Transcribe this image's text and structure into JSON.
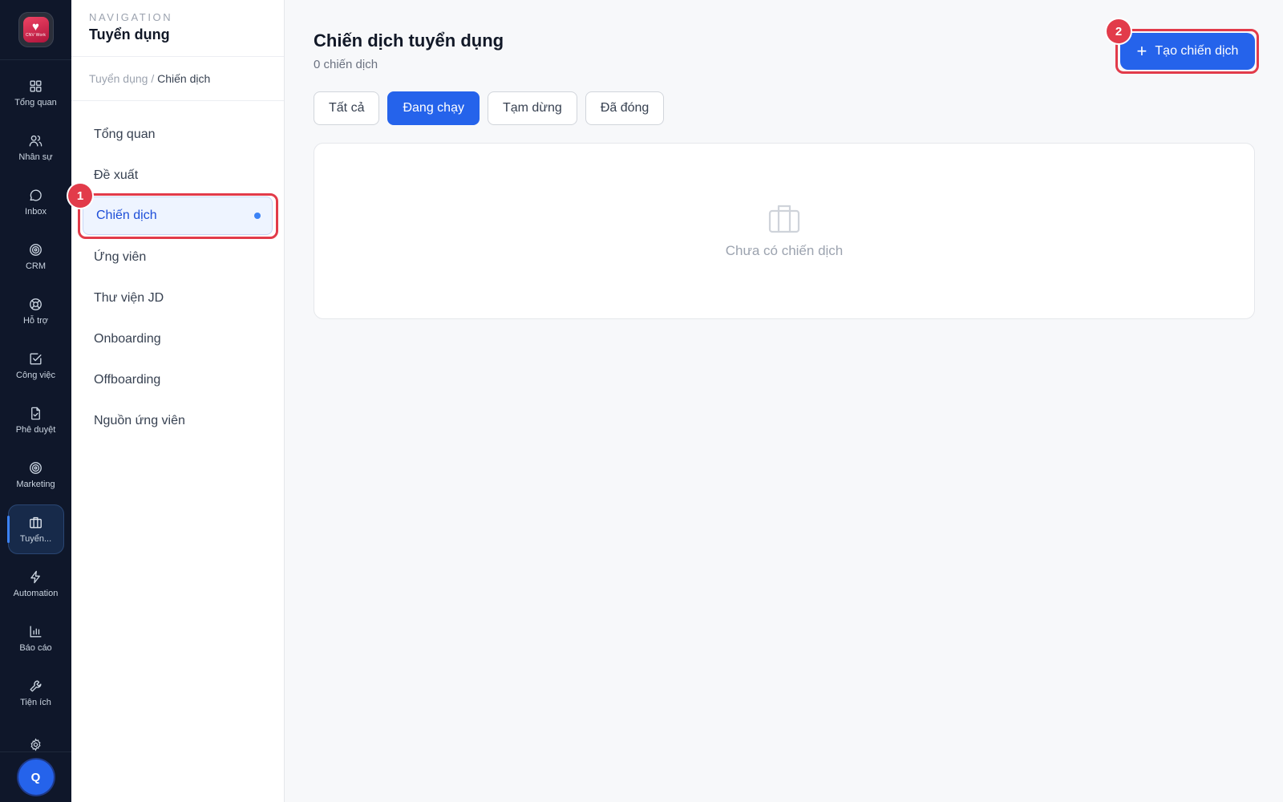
{
  "rail": {
    "logo_brand": "CNV Work",
    "items": [
      {
        "label": "Tổng quan",
        "icon": "grid-icon"
      },
      {
        "label": "Nhân sự",
        "icon": "users-icon"
      },
      {
        "label": "Inbox",
        "icon": "chat-icon"
      },
      {
        "label": "CRM",
        "icon": "target-icon"
      },
      {
        "label": "Hỗ trợ",
        "icon": "lifebuoy-icon"
      },
      {
        "label": "Công việc",
        "icon": "checkbox-icon"
      },
      {
        "label": "Phê duyệt",
        "icon": "document-icon"
      },
      {
        "label": "Marketing",
        "icon": "target-icon"
      },
      {
        "label": "Tuyển...",
        "icon": "briefcase-icon"
      },
      {
        "label": "Automation",
        "icon": "lightning-icon"
      },
      {
        "label": "Báo cáo",
        "icon": "bar-chart-icon"
      },
      {
        "label": "Tiện ích",
        "icon": "wrench-icon"
      }
    ],
    "avatar_initial": "Q"
  },
  "nav": {
    "caption": "NAVIGATION",
    "title": "Tuyển dụng",
    "breadcrumb_parent": "Tuyển dụng",
    "breadcrumb_sep": " / ",
    "breadcrumb_current": "Chiến dịch",
    "items": [
      {
        "label": "Tổng quan"
      },
      {
        "label": "Đề xuất"
      },
      {
        "label": "Chiến dịch",
        "active": true
      },
      {
        "label": "Ứng viên"
      },
      {
        "label": "Thư viện JD"
      },
      {
        "label": "Onboarding"
      },
      {
        "label": "Offboarding"
      },
      {
        "label": "Nguồn ứng viên"
      }
    ]
  },
  "main": {
    "title": "Chiến dịch tuyển dụng",
    "subtitle": "0 chiến dịch",
    "create_label": "Tạo chiến dịch",
    "tabs": [
      {
        "label": "Tất cả"
      },
      {
        "label": "Đang chạy",
        "active": true
      },
      {
        "label": "Tạm dừng"
      },
      {
        "label": "Đã đóng"
      }
    ],
    "empty_text": "Chưa có chiến dịch"
  },
  "annotations": {
    "badge_1": "1",
    "badge_2": "2",
    "color": "#e23b4a"
  },
  "colors": {
    "accent": "#2563eb",
    "rail_bg": "#0f172a"
  }
}
